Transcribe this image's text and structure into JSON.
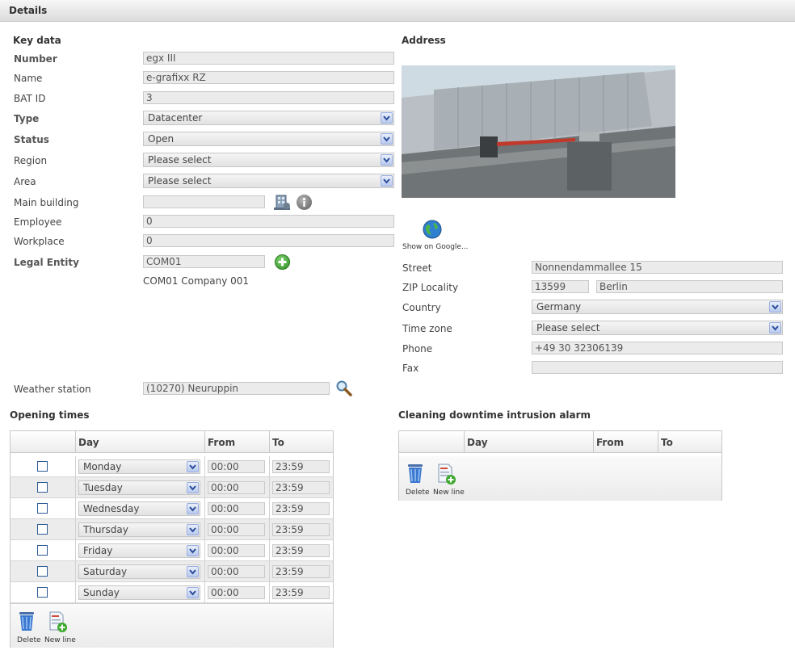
{
  "header": {
    "title": "Details"
  },
  "key_data": {
    "title": "Key data",
    "number": {
      "label": "Number",
      "value": "egx III"
    },
    "name": {
      "label": "Name",
      "value": "e-grafixx RZ"
    },
    "bat_id": {
      "label": "BAT ID",
      "value": "3"
    },
    "type": {
      "label": "Type",
      "value": "Datacenter"
    },
    "status": {
      "label": "Status",
      "value": "Open"
    },
    "region": {
      "label": "Region",
      "value": "Please select"
    },
    "area": {
      "label": "Area",
      "value": "Please select"
    },
    "main_building": {
      "label": "Main building",
      "value": ""
    },
    "employee": {
      "label": "Employee",
      "value": "0"
    },
    "workplace": {
      "label": "Workplace",
      "value": "0"
    },
    "legal_entity": {
      "label": "Legal Entity",
      "value": "COM01",
      "description": "COM01 Company 001"
    },
    "weather_station": {
      "label": "Weather station",
      "value": "(10270) Neuruppin"
    }
  },
  "address": {
    "title": "Address",
    "google_label": "Show on Google...",
    "street": {
      "label": "Street",
      "value": "Nonnendammallee 15"
    },
    "zip_locality": {
      "label": "ZIP Locality",
      "zip": "13599",
      "city": "Berlin"
    },
    "country": {
      "label": "Country",
      "value": "Germany"
    },
    "time_zone": {
      "label": "Time zone",
      "value": "Please select"
    },
    "phone": {
      "label": "Phone",
      "value": "+49 30 32306139"
    },
    "fax": {
      "label": "Fax",
      "value": ""
    }
  },
  "opening_times": {
    "title": "Opening times",
    "columns": [
      "Day",
      "From",
      "To"
    ],
    "rows": [
      {
        "day": "Monday",
        "from": "00:00",
        "to": "23:59"
      },
      {
        "day": "Tuesday",
        "from": "00:00",
        "to": "23:59"
      },
      {
        "day": "Wednesday",
        "from": "00:00",
        "to": "23:59"
      },
      {
        "day": "Thursday",
        "from": "00:00",
        "to": "23:59"
      },
      {
        "day": "Friday",
        "from": "00:00",
        "to": "23:59"
      },
      {
        "day": "Saturday",
        "from": "00:00",
        "to": "23:59"
      },
      {
        "day": "Sunday",
        "from": "00:00",
        "to": "23:59"
      }
    ],
    "delete_label": "Delete",
    "new_line_label": "New line"
  },
  "cleaning": {
    "title": "Cleaning downtime intrusion alarm",
    "columns": [
      "Day",
      "From",
      "To"
    ],
    "delete_label": "Delete",
    "new_line_label": "New line"
  },
  "icons": {
    "main_building_icon": "building-icon",
    "main_building_info": "info-icon",
    "legal_entity_add": "add-icon",
    "weather_search": "magnifier-icon",
    "google": "globe-icon",
    "delete": "trash-icon",
    "new_line": "new-document-icon"
  },
  "colors": {
    "accent": "#98aee0",
    "add_green": "#3a9b2f"
  }
}
